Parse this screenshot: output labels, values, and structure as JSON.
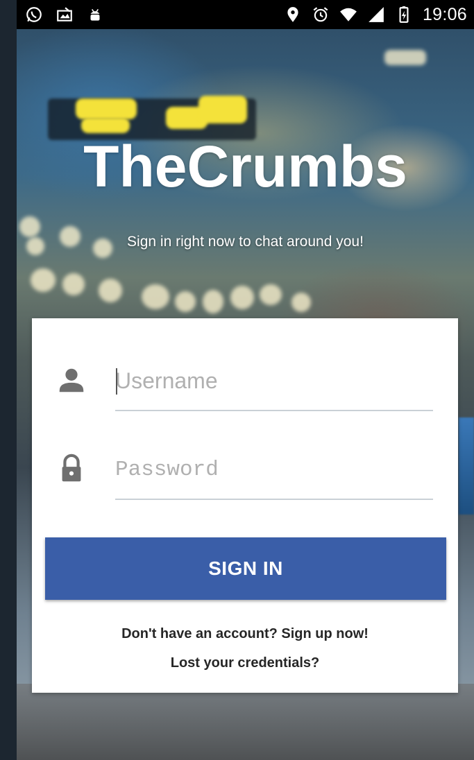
{
  "status_bar": {
    "time": "19:06",
    "left_icons": [
      "whatsapp-icon",
      "image-notification-icon",
      "android-debug-icon"
    ],
    "right_icons": [
      "location-icon",
      "alarm-icon",
      "wifi-icon",
      "signal-icon",
      "battery-icon"
    ]
  },
  "header": {
    "app_name": "TheCrumbs",
    "tagline": "Sign in right now to chat around you!"
  },
  "login": {
    "username": {
      "value": "",
      "placeholder": "Username",
      "icon": "person-icon"
    },
    "password": {
      "value": "",
      "placeholder": "Password",
      "icon": "lock-icon"
    },
    "signin_label": "SIGN IN",
    "signup_link": "Don't have an account? Sign up now!",
    "lost_link": "Lost your credentials?"
  },
  "colors": {
    "primary": "#3a5ea8",
    "card_bg": "#ffffff",
    "status_bar_bg": "#000000"
  }
}
